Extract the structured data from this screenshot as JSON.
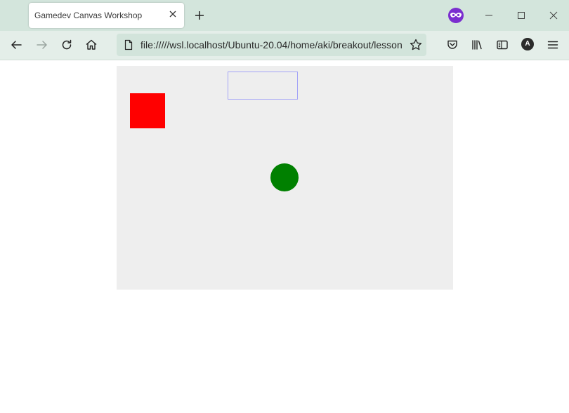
{
  "tabbar": {
    "tab_title": "Gamedev Canvas Workshop",
    "icons": {
      "close": "close-icon",
      "new_tab": "plus-icon",
      "private": "private-browsing-icon",
      "minimize": "minimize-icon",
      "maximize": "maximize-icon",
      "close_window": "close-window-icon"
    }
  },
  "navbar": {
    "url": "file://///wsl.localhost/Ubuntu-20.04/home/aki/breakout/lesson",
    "avatar_letter": "A",
    "icons": {
      "back": "back-arrow-icon",
      "forward": "forward-arrow-icon",
      "reload": "reload-icon",
      "home": "home-icon",
      "file": "file-icon",
      "bookmark": "star-icon",
      "pocket": "pocket-icon",
      "library": "library-icon",
      "sidebar": "sidebar-icon",
      "menu": "hamburger-menu-icon"
    }
  },
  "canvas": {
    "background": "#eeeeee",
    "shapes": [
      {
        "kind": "outlined-rectangle",
        "stroke": "rgba(90,90,255,0.5)"
      },
      {
        "kind": "filled-square",
        "fill": "#ff0000"
      },
      {
        "kind": "filled-circle",
        "fill": "#008000"
      }
    ]
  },
  "colors": {
    "tabbar_bg": "#d3e5dc",
    "navbar_bg": "#e4eee9",
    "urlbar_bg": "#d2e4db",
    "private_purple": "#7b2ecf"
  }
}
